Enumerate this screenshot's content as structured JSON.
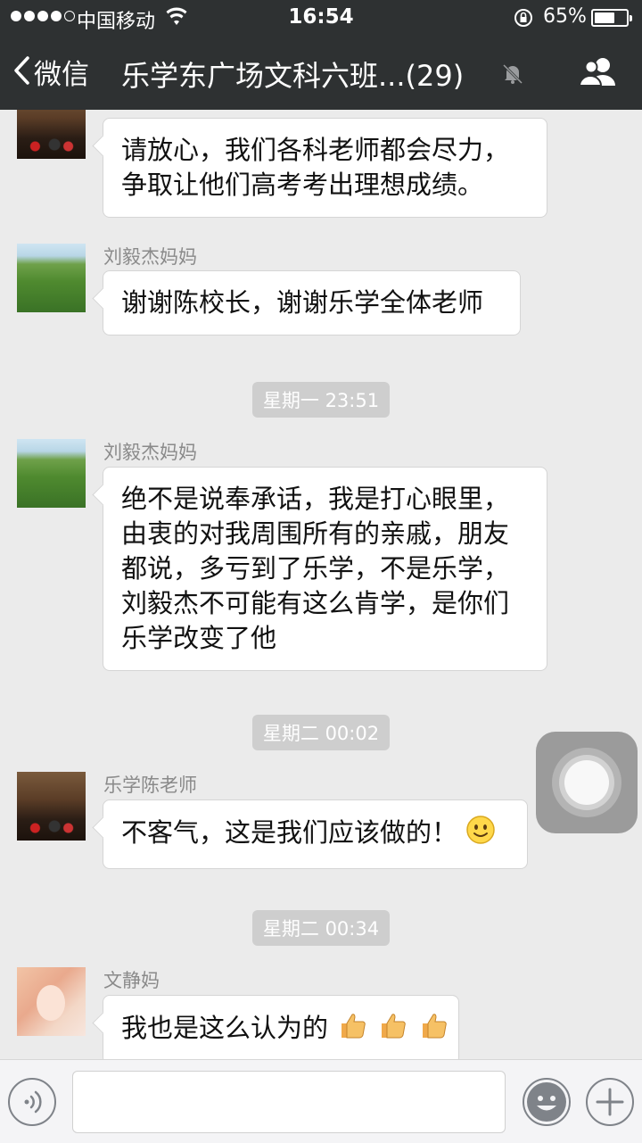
{
  "status_bar": {
    "carrier": "中国移动",
    "time": "16:54",
    "battery_percent": "65%",
    "battery_level": 0.65,
    "signal_bars_filled": 4,
    "signal_bars_total": 5
  },
  "nav": {
    "back_label": "微信",
    "title": "乐学东广场文科六班...(29)",
    "icons": [
      "chevron-left-icon",
      "mute-bell-icon",
      "group-contacts-icon"
    ]
  },
  "chat": {
    "messages": [
      {
        "sender": "",
        "avatar": "hall-photo",
        "lines": [
          "请放心，我们各科老师都会尽力，",
          "争取让他们高考考出理想成绩。"
        ]
      },
      {
        "sender": "刘毅杰妈妈",
        "avatar": "mountain-photo",
        "lines": [
          "谢谢陈校长，谢谢乐学全体老师"
        ]
      },
      {
        "timestamp": "星期一 23:51"
      },
      {
        "sender": "刘毅杰妈妈",
        "avatar": "mountain-photo",
        "lines": [
          "绝不是说奉承话，我是打心眼里，",
          "由衷的对我周围所有的亲戚，朋友",
          "都说，多亏到了乐学，不是乐学，",
          "刘毅杰不可能有这么肯学，是你们",
          "乐学改变了他"
        ]
      },
      {
        "timestamp": "星期二 00:02"
      },
      {
        "sender": "乐学陈老师",
        "avatar": "hall-photo",
        "lines": [
          "不客气，这是我们应该做的！"
        ],
        "emoji": "smile-emoji"
      },
      {
        "timestamp": "星期二 00:34"
      },
      {
        "sender": "文静妈",
        "avatar": "woman-photo",
        "lines": [
          "我也是这么认为的"
        ],
        "emoji": "thumbs-up-emoji x3"
      }
    ]
  },
  "input_bar": {
    "placeholder": "",
    "icons": [
      "voice-icon",
      "emoji-icon",
      "plus-icon"
    ]
  },
  "colors": {
    "nav_bg": "#2e3132",
    "chat_bg": "#ebebeb",
    "bubble_bg": "#ffffff",
    "timestamp_bg": "#cecece",
    "sender_text": "#8a8a8a"
  }
}
